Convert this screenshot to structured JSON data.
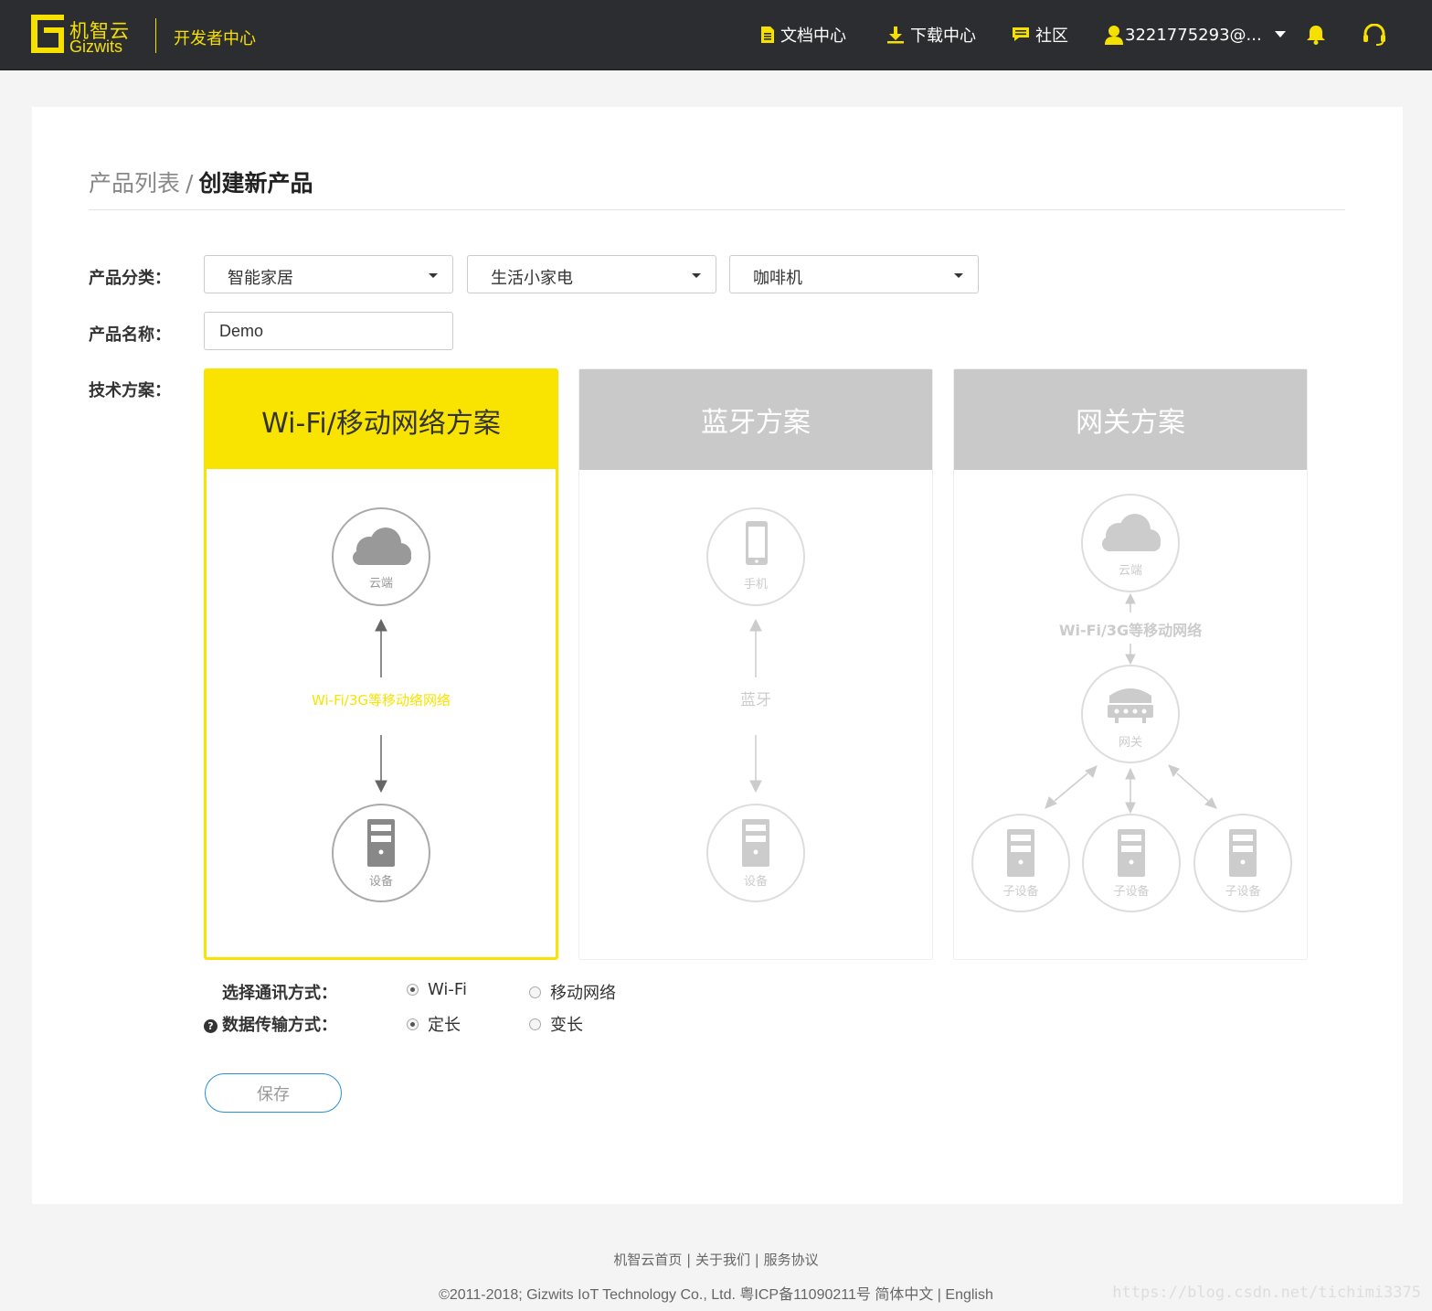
{
  "header": {
    "logo_cn": "机智云",
    "logo_en": "Gizwits",
    "dev_center": "开发者中心",
    "nav": {
      "docs": "文档中心",
      "download": "下载中心",
      "community": "社区",
      "user": "3221775293@..."
    }
  },
  "breadcrumb": {
    "parent": "产品列表",
    "separator": "/",
    "current": "创建新产品"
  },
  "form": {
    "category_label": "产品分类：",
    "category": [
      "智能家居",
      "生活小家电",
      "咖啡机"
    ],
    "name_label": "产品名称：",
    "name_value": "Demo",
    "tech_label": "技术方案："
  },
  "schemes": [
    {
      "title": "Wi-Fi/移动网络方案",
      "active": true,
      "top_node": "云端",
      "link": "Wi-Fi/3G等移动络网络",
      "bottom_node": "设备"
    },
    {
      "title": "蓝牙方案",
      "active": false,
      "top_node": "手机",
      "link": "蓝牙",
      "bottom_node": "设备"
    },
    {
      "title": "网关方案",
      "active": false,
      "top_node": "云端",
      "link": "Wi-Fi/3G等移动网络",
      "middle_node": "网关",
      "sub_nodes": [
        "子设备",
        "子设备",
        "子设备"
      ]
    }
  ],
  "options": {
    "comm_label": "选择通讯方式：",
    "comm": [
      {
        "label": "Wi-Fi",
        "checked": true
      },
      {
        "label": "移动网络",
        "checked": false
      }
    ],
    "data_label": "数据传输方式：",
    "data": [
      {
        "label": "定长",
        "checked": true
      },
      {
        "label": "变长",
        "checked": false
      }
    ]
  },
  "save_label": "保存",
  "footer": {
    "links": [
      "机智云首页",
      "关于我们",
      "服务协议"
    ],
    "copyright": "©2011-2018; Gizwits IoT Technology Co., Ltd. 粤ICP备11090211号",
    "lang_cn": "简体中文",
    "lang_en": "English"
  },
  "watermark": "https://blog.csdn.net/tichimi3375",
  "colors": {
    "topbar": "#2c2d31",
    "brand_yellow": "#f8e400",
    "inactive_head": "#c9c9c9",
    "button_border": "#2a8fd6"
  }
}
